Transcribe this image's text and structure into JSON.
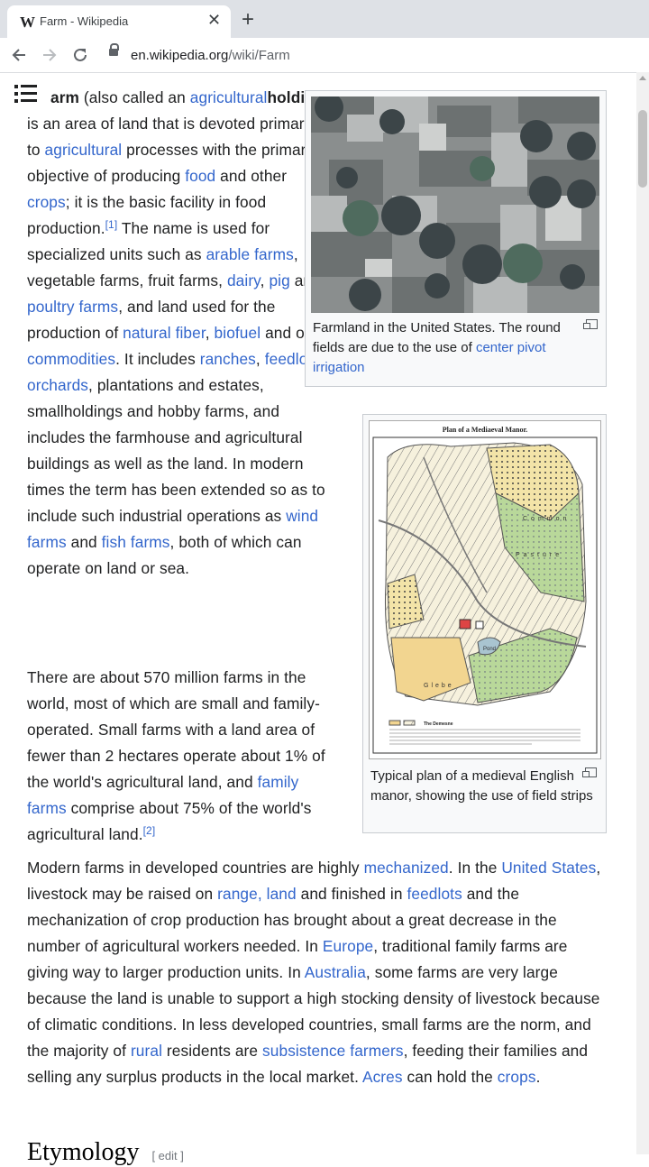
{
  "browser": {
    "tab_favicon": "W",
    "tab_title": "Farm - Wikipedia",
    "tab_close": "✕",
    "new_tab": "+",
    "url_domain": "en.wikipedia.org",
    "url_path": "/wiki/Farm"
  },
  "article": {
    "p1": [
      [
        "",
        "arm"
      ],
      [
        "",
        " (also called an "
      ],
      [
        "a",
        "agricultural"
      ],
      [
        "",
        ""
      ],
      [
        "b",
        "holding"
      ],
      [
        "",
        ") is an area of land that is devoted primarily to "
      ],
      [
        "a",
        "agricultural"
      ],
      [
        "",
        " processes with the primary objective of producing "
      ],
      [
        "a",
        "food"
      ],
      [
        "",
        " and other "
      ],
      [
        "a",
        "crops"
      ],
      [
        "",
        "; it is the basic facility in food production."
      ],
      [
        "s",
        "[1]"
      ],
      [
        "",
        " The name is used for specialized units such as "
      ],
      [
        "a",
        "arable farms"
      ],
      [
        "",
        ", vegetable farms, fruit farms, "
      ],
      [
        "a",
        "dairy"
      ],
      [
        "",
        ", "
      ],
      [
        "a",
        "pig"
      ],
      [
        "",
        " and "
      ],
      [
        "a",
        "poultry farms"
      ],
      [
        "",
        ", and land used for the production of "
      ],
      [
        "a",
        "natural fiber"
      ],
      [
        "",
        ", "
      ],
      [
        "a",
        "biofuel"
      ],
      [
        "",
        " and other "
      ],
      [
        "a",
        "commodities"
      ],
      [
        "",
        ". It includes "
      ],
      [
        "a",
        "ranches"
      ],
      [
        "",
        ", "
      ],
      [
        "a",
        "feedlots"
      ],
      [
        "",
        ", "
      ],
      [
        "a",
        "orchards"
      ],
      [
        "",
        ", plantations and estates, smallholdings and hobby farms, and includes the farmhouse and agricultural buildings as well as the land. In modern times the term has been extended so as to include such industrial operations as "
      ],
      [
        "a",
        "wind farms"
      ],
      [
        "",
        " and "
      ],
      [
        "a",
        "fish farms"
      ],
      [
        "",
        ", both of which can operate on land or sea."
      ]
    ],
    "p2": [
      [
        "",
        "There are about 570 million farms in the world, most of which are small and family-operated. Small farms with a land area of fewer than 2 hectares operate about 1% of the world's agricultural land, and "
      ],
      [
        "a",
        "family farms"
      ],
      [
        "",
        " comprise about 75% of the world's agricultural land."
      ],
      [
        "s",
        "[2]"
      ]
    ],
    "p3": [
      [
        "",
        "Modern farms in developed countries are highly "
      ],
      [
        "a",
        "mechanized"
      ],
      [
        "",
        ". In the "
      ],
      [
        "a",
        "United States"
      ],
      [
        "",
        ", livestock may be raised on "
      ],
      [
        "a",
        "range, land"
      ],
      [
        "",
        " and finished in "
      ],
      [
        "a",
        "feedlots"
      ],
      [
        "",
        " and the mechanization of crop production has brought about a great decrease in the number of agricultural workers needed. In "
      ],
      [
        "a",
        "Europe"
      ],
      [
        "",
        ", traditional family farms are giving way to larger production units. In "
      ],
      [
        "a",
        "Australia"
      ],
      [
        "",
        ", some farms are very large because the land is unable to support a high stocking density of livestock because of climatic conditions. In less developed countries, small farms are the norm, and the majority of "
      ],
      [
        "a",
        "rural"
      ],
      [
        "",
        " residents are "
      ],
      [
        "a",
        "subsistence farmers"
      ],
      [
        "",
        ", feeding their families and selling any surplus products in the local market. "
      ],
      [
        "a",
        "Acres"
      ],
      [
        "",
        " can hold the "
      ],
      [
        "a",
        "crops"
      ],
      [
        "",
        "."
      ]
    ],
    "heading": "Etymology",
    "heading_edit": "[ edit ]"
  },
  "figure1": {
    "caption_text": "Farmland in the United States. The round fields are due to the use of ",
    "caption_link": "center pivot irrigation"
  },
  "figure2": {
    "map_title": "Plan of a Mediaeval Manor.",
    "map_labels": [
      "Common",
      "Pasture",
      "Pond",
      "Glebe",
      "The Demesne"
    ],
    "caption_text": "Typical plan of a medieval English manor, showing the use of field strips"
  },
  "colors": {
    "link": "#3366cc",
    "text": "#202122"
  }
}
